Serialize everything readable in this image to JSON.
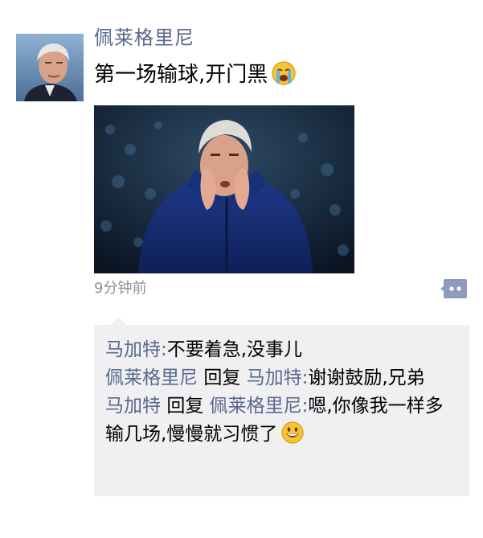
{
  "post": {
    "author": "佩莱格里尼",
    "text": "第一场输球,开门黑",
    "time": "9分钟前"
  },
  "comments": [
    {
      "name": "马加特",
      "sep": ":",
      "text": "不要着急,没事儿"
    },
    {
      "name": "佩莱格里尼",
      "reply": "回复",
      "target": "马加特",
      "sep": ":",
      "text": "谢谢鼓励,兄弟"
    },
    {
      "name": "马加特",
      "reply": "回复",
      "target": "佩莱格里尼",
      "sep": ":",
      "text": "嗯,你像我一样多输几场,慢慢就习惯了"
    }
  ],
  "colors": {
    "name": "#57698d",
    "time": "#8f8f8f",
    "comment_bg": "#f0f0f2"
  },
  "icons": {
    "post_emoji": "crying-face-icon",
    "reply_emoji": "grinning-face-icon",
    "comment_button": "comment-bubble-icon"
  }
}
